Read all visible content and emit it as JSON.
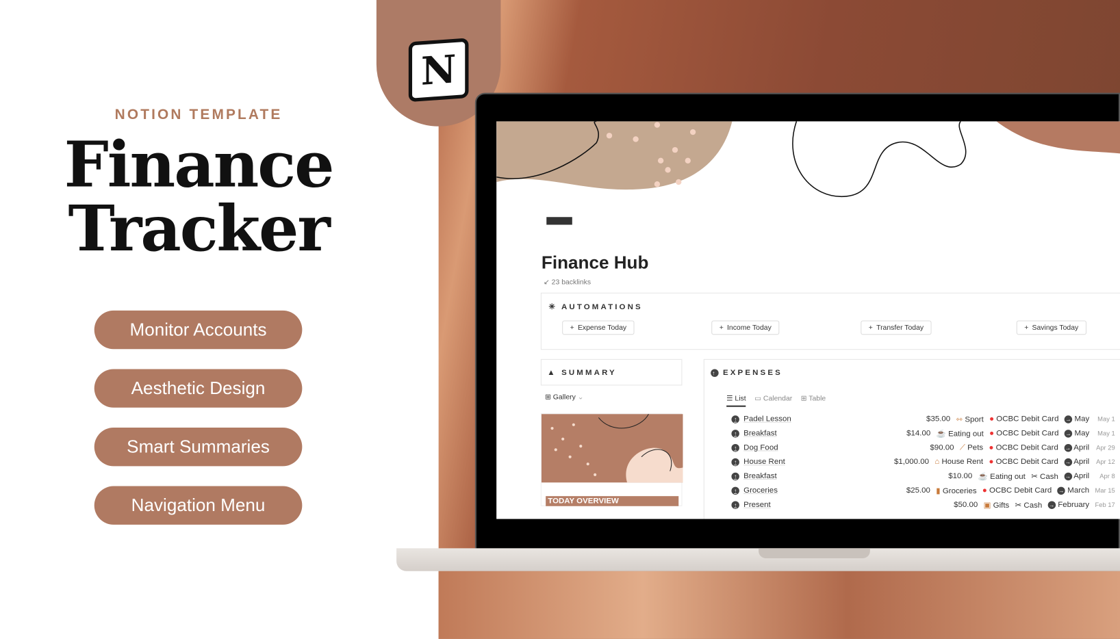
{
  "promo": {
    "eyebrow": "NOTION TEMPLATE",
    "title_line1": "Finance",
    "title_line2": "Tracker",
    "features": [
      "Monitor Accounts",
      "Aesthetic Design",
      "Smart Summaries",
      "Navigation Menu"
    ],
    "logo": "N"
  },
  "colors": {
    "accent": "#b07a62",
    "brand_text": "#b07a5e"
  },
  "page": {
    "title": "Finance Hub",
    "backlinks": "23 backlinks",
    "automations": {
      "heading": "AUTOMATIONS",
      "buttons": [
        "Expense Today",
        "Income Today",
        "Transfer Today",
        "Savings Today"
      ]
    },
    "summary": {
      "heading": "SUMMARY",
      "view": "Gallery",
      "card_label": "TODAY OVERVIEW"
    },
    "expenses": {
      "heading": "EXPENSES",
      "views": [
        "List",
        "Calendar",
        "Table"
      ],
      "rows": [
        {
          "name": "Padel Lesson",
          "amount": "$35.00",
          "category": "Sport",
          "account": "OCBC Debit Card",
          "month": "May",
          "date": "May 1"
        },
        {
          "name": "Breakfast",
          "amount": "$14.00",
          "category": "Eating out",
          "account": "OCBC Debit Card",
          "month": "May",
          "date": "May 1"
        },
        {
          "name": "Dog Food",
          "amount": "$90.00",
          "category": "Pets",
          "account": "OCBC Debit Card",
          "month": "April",
          "date": "Apr 29"
        },
        {
          "name": "House Rent",
          "amount": "$1,000.00",
          "category": "House Rent",
          "account": "OCBC Debit Card",
          "month": "April",
          "date": "Apr 12"
        },
        {
          "name": "Breakfast",
          "amount": "$10.00",
          "category": "Eating out",
          "account": "Cash",
          "month": "April",
          "date": "Apr 8"
        },
        {
          "name": "Groceries",
          "amount": "$25.00",
          "category": "Groceries",
          "account": "OCBC Debit Card",
          "month": "March",
          "date": "Mar 15"
        },
        {
          "name": "Present",
          "amount": "$50.00",
          "category": "Gifts",
          "account": "Cash",
          "month": "February",
          "date": "Feb 17"
        }
      ]
    }
  }
}
